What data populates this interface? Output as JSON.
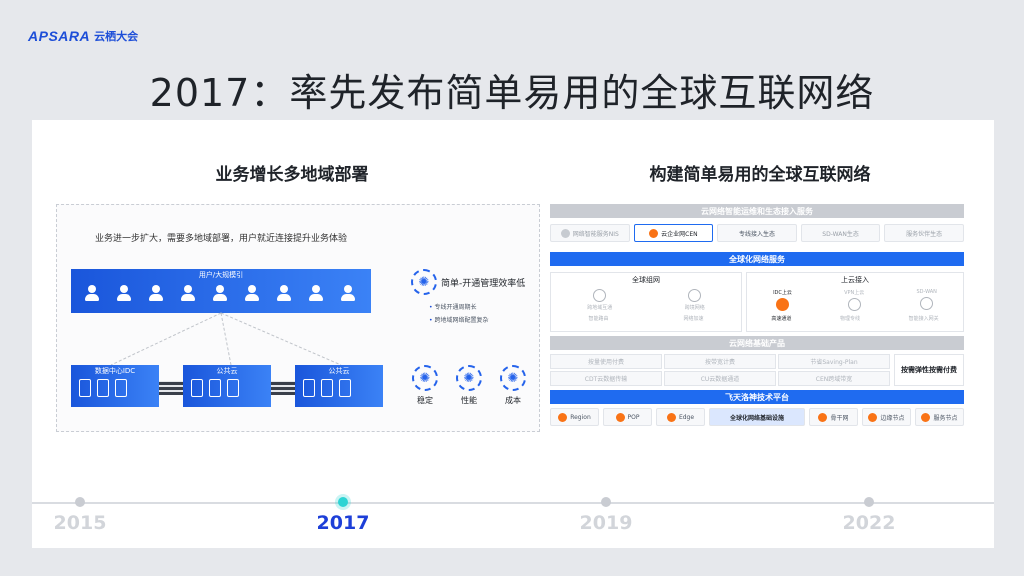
{
  "brand": {
    "logo": "APSARA",
    "name": "云栖大会"
  },
  "title": "2017：率先发布简单易用的全球互联网络",
  "left": {
    "subtitle": "业务增长多地域部署",
    "description": "业务进一步扩大，需要多地域部署，用户就近连接提升业务体验",
    "users_label": "用户/大规模引",
    "nodes": [
      "数据中心IDC",
      "公共云",
      "公共云"
    ],
    "feature_title": "简单-开通管理效率低",
    "feature_points": [
      "专线开通周期长",
      "跨地域网络配置复杂"
    ],
    "metrics": [
      "稳定",
      "性能",
      "成本"
    ]
  },
  "right": {
    "subtitle": "构建简单易用的全球互联网络",
    "band1": "云网络智能运维和生态接入服务",
    "row1": [
      "网络智能服务NIS",
      "云企业网CEN",
      "专线接入生态",
      "SD-WAN生态",
      "服务伙伴生态"
    ],
    "band2": "全球化网络服务",
    "global_net": {
      "title": "全球组网",
      "items": [
        "跨地域互通",
        "跨境网络",
        "智能路由",
        "网络加速"
      ]
    },
    "cloud_access": {
      "title": "上云接入",
      "items": [
        "IDC上云",
        "VPN上云",
        "SD-WAN",
        "高速通道",
        "物理专线",
        "智能接入网关"
      ]
    },
    "band3": "云网络基础产品",
    "foundation": [
      "按量使用付费",
      "按带宽计费",
      "节省Saving-Plan",
      "CDT云数据传输",
      "CU云数据通道",
      "CEN跨域带宽"
    ],
    "foundation_side": "按需弹性按需付费",
    "band4": "飞天洛神技术平台",
    "row4": [
      "Region",
      "POP",
      "Edge",
      "全球化网络基础设施",
      "骨干网",
      "边缘节点",
      "服务节点"
    ]
  },
  "timeline": {
    "years": [
      "2015",
      "2017",
      "2019",
      "2022"
    ],
    "active_index": 1
  },
  "colors": {
    "accent": "#1d4ed8",
    "band_blue": "#1f6bf0",
    "active_dot": "#2dd4d4"
  }
}
